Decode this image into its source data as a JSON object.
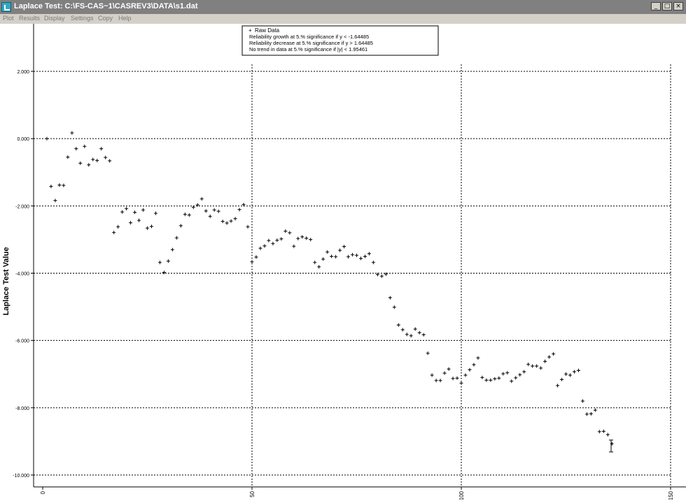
{
  "window": {
    "title": "Laplace Test:  C:\\FS-CAS~1\\CASREV3\\DATA\\s1.dat",
    "buttons": {
      "minimize": "_",
      "maximize": "□",
      "close": "×"
    }
  },
  "menu": [
    "Plot",
    "Results",
    "Display",
    "Settings",
    "Copy",
    "Help"
  ],
  "legend": {
    "placement": "top-center",
    "entries": [
      {
        "marker": "+",
        "label": "Raw Data"
      },
      {
        "marker": "",
        "label": "Reliability growth at 5.% significance if y < -1.64485"
      },
      {
        "marker": "",
        "label": "Reliability decrease at 5.% significance if y > 1.64485"
      },
      {
        "marker": "",
        "label": "No trend in data at 5.% significance if |y| < 1.95461"
      }
    ]
  },
  "chart_data": {
    "type": "scatter",
    "xlabel": "",
    "ylabel": "Laplace Test Value",
    "xlim": [
      -2,
      150
    ],
    "ylim": [
      -10,
      2
    ],
    "grid": true,
    "x_ticks": [
      "0",
      "50",
      "100",
      "150"
    ],
    "y_ticks": [
      "2.000",
      "0.000",
      "-2.000",
      "-4.000",
      "-6.000",
      "-8.000",
      "-10.000"
    ],
    "x_tick_values": [
      0,
      50,
      100,
      150
    ],
    "y_tick_values": [
      2,
      0,
      -2,
      -4,
      -6,
      -8,
      -10
    ],
    "series": [
      {
        "name": "Raw Data",
        "marker": "+",
        "x": [
          1,
          2,
          3,
          4,
          5,
          6,
          7,
          8,
          9,
          10,
          11,
          12,
          13,
          14,
          15,
          16,
          17,
          18,
          19,
          20,
          21,
          22,
          23,
          24,
          25,
          26,
          27,
          28,
          29,
          30,
          31,
          32,
          33,
          34,
          35,
          36,
          37,
          38,
          39,
          40,
          41,
          42,
          43,
          44,
          45,
          46,
          47,
          48,
          49,
          50,
          51,
          52,
          53,
          54,
          55,
          56,
          57,
          58,
          59,
          60,
          61,
          62,
          63,
          64,
          65,
          66,
          67,
          68,
          69,
          70,
          71,
          72,
          73,
          74,
          75,
          76,
          77,
          78,
          79,
          80,
          81,
          82,
          83,
          84,
          85,
          86,
          87,
          88,
          89,
          90,
          91,
          92,
          93,
          94,
          95,
          96,
          97,
          98,
          99,
          100,
          101,
          102,
          103,
          104,
          105,
          106,
          107,
          108,
          109,
          110,
          111,
          112,
          113,
          114,
          115,
          116,
          117,
          118,
          119,
          120,
          121,
          122,
          123,
          124,
          125,
          126,
          127,
          128,
          129,
          130,
          131,
          132,
          133,
          134,
          135,
          136
        ],
        "y": [
          0.0,
          -1.42,
          -1.84,
          -1.38,
          -1.39,
          -0.55,
          0.17,
          -0.3,
          -0.73,
          -0.23,
          -0.78,
          -0.62,
          -0.65,
          -0.3,
          -0.56,
          -0.66,
          -2.79,
          -2.62,
          -2.18,
          -2.08,
          -2.5,
          -2.19,
          -2.43,
          -2.12,
          -2.66,
          -2.61,
          -2.22,
          -3.68,
          -3.98,
          -3.64,
          -3.3,
          -2.95,
          -2.59,
          -2.25,
          -2.27,
          -2.04,
          -1.97,
          -1.79,
          -2.15,
          -2.31,
          -2.12,
          -2.16,
          -2.46,
          -2.51,
          -2.45,
          -2.38,
          -2.11,
          -1.96,
          -2.62,
          -3.66,
          -3.52,
          -3.26,
          -3.19,
          -3.03,
          -3.12,
          -3.02,
          -2.98,
          -2.75,
          -2.8,
          -3.2,
          -2.97,
          -2.92,
          -2.96,
          -3.0,
          -3.68,
          -3.81,
          -3.58,
          -3.37,
          -3.5,
          -3.51,
          -3.32,
          -3.21,
          -3.51,
          -3.45,
          -3.47,
          -3.56,
          -3.5,
          -3.42,
          -3.68,
          -4.04,
          -4.09,
          -4.03,
          -4.73,
          -5.01,
          -5.54,
          -5.68,
          -5.82,
          -5.86,
          -5.66,
          -5.77,
          -5.83,
          -6.38,
          -7.03,
          -7.19,
          -7.19,
          -6.97,
          -6.85,
          -7.13,
          -7.12,
          -7.27,
          -7.03,
          -6.87,
          -6.72,
          -6.52,
          -7.1,
          -7.18,
          -7.18,
          -7.14,
          -7.12,
          -6.99,
          -6.96,
          -7.21,
          -7.11,
          -7.02,
          -6.93,
          -6.71,
          -6.76,
          -6.76,
          -6.82,
          -6.62,
          -6.49,
          -6.4,
          -7.34,
          -7.16,
          -7.0,
          -7.03,
          -6.93,
          -6.89,
          -7.8,
          -8.19,
          -8.18,
          -8.07,
          -8.71,
          -8.7,
          -8.8,
          -9.07
        ]
      }
    ]
  }
}
